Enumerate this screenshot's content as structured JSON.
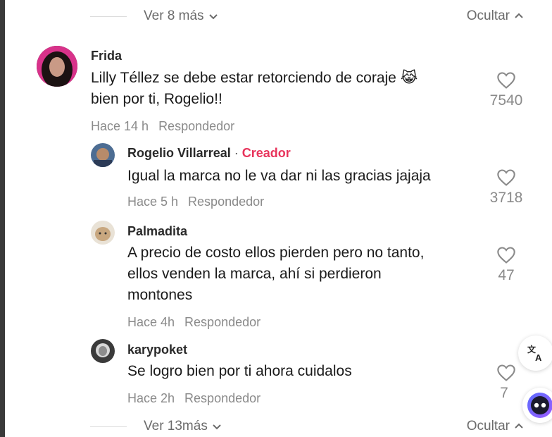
{
  "top_bar": {
    "more_label": "Ver 8 más",
    "hide_label": "Ocultar"
  },
  "comments": [
    {
      "author": "Frida",
      "text_lines": [
        "Lilly Téllez se debe estar retorciendo de coraje 😹",
        "bien por ti, Rogelio!!"
      ],
      "time": "Hace 14 h",
      "reply": "Respondedor",
      "likes": "7540"
    },
    {
      "author": "Rogelio Villarreal",
      "separator": "·",
      "badge": "Creador",
      "text_lines": [
        "Igual la marca no le va dar ni las gracias jajaja"
      ],
      "time": "Hace 5 h",
      "reply": "Respondedor",
      "likes": "3718"
    },
    {
      "author": "Palmadita",
      "text_lines": [
        "A precio de costo ellos pierden pero no tanto,",
        "ellos venden la marca, ahí si perdieron",
        "montones"
      ],
      "time": "Hace 4h",
      "reply": "Respondedor",
      "likes": "47"
    },
    {
      "author": "karypoket",
      "text_lines": [
        "Se logro bien por ti ahora cuidalos"
      ],
      "time": "Hace 2h",
      "reply": "Respondedor",
      "likes": "7"
    }
  ],
  "bottom_bar": {
    "more_label": "Ver 13más",
    "hide_label": "Ocultar"
  },
  "floating": {
    "translate_icon": "translate-icon",
    "assistant_icon": "assistant-eyes-icon"
  },
  "colors": {
    "creator_badge": "#e8345c",
    "muted_text": "#8a8a8a"
  }
}
